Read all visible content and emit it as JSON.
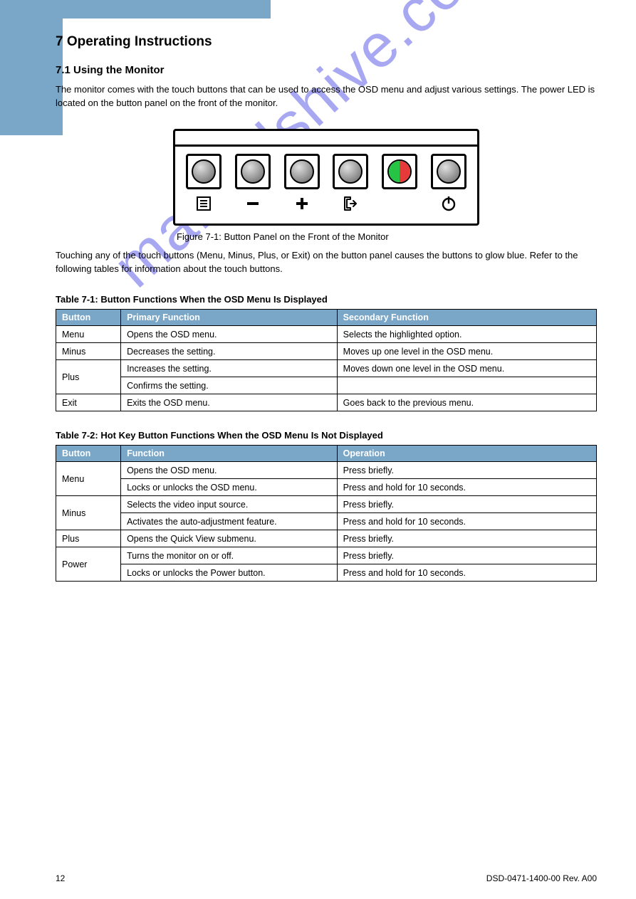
{
  "watermark": "manualshive.com",
  "section7": {
    "num": "7",
    "title": "Operating Instructions",
    "sub1": {
      "num": "7.1",
      "title": "Using the Monitor",
      "paragraph": "The monitor comes with the touch buttons that can be used to access the OSD menu and adjust various settings. The power LED is located on the button panel on the front of the monitor.",
      "figure_caption": "Figure 7-1: Button Panel on the Front of the Monitor",
      "explain": "Touching any of the touch buttons (Menu, Minus, Plus, or Exit) on the button panel causes the buttons to glow blue. Refer to the following tables for information about the touch buttons."
    },
    "table1": {
      "title": "Table 7-1: Button Functions When the OSD Menu Is Displayed",
      "headers": [
        "Button",
        "Primary Function",
        "Secondary Function"
      ],
      "rows": [
        [
          "Menu",
          "Opens the OSD menu.",
          "Selects the highlighted option."
        ],
        [
          "Minus",
          "Decreases the setting.",
          "Moves up one level in the OSD menu."
        ],
        [
          "Plus",
          "Increases the setting.",
          "Moves down one level in the OSD menu."
        ],
        [
          "",
          "Confirms the setting.",
          ""
        ],
        [
          "Exit",
          "Exits the OSD menu.",
          "Goes back to the previous menu."
        ]
      ]
    },
    "table2": {
      "title": "Table 7-2: Hot Key Button Functions When the OSD Menu Is Not Displayed",
      "headers": [
        "Button",
        "Function",
        "Operation"
      ],
      "rows": [
        [
          "Menu",
          "Opens the OSD menu.",
          "Press briefly."
        ],
        [
          "",
          "Locks or unlocks the OSD menu.",
          "Press and hold for 10 seconds."
        ],
        [
          "Minus",
          "Selects the video input source.",
          "Press briefly."
        ],
        [
          "",
          "Activates the auto-adjustment feature.",
          "Press and hold for 10 seconds."
        ],
        [
          "Plus",
          "Opens the Quick View submenu.",
          "Press briefly."
        ],
        [
          "Power",
          "Turns the monitor on or off.",
          "Press briefly."
        ],
        [
          "",
          "Locks or unlocks the Power button.",
          "Press and hold for 10 seconds."
        ]
      ]
    }
  },
  "footer": {
    "page": "12",
    "revision": "DSD-0471-1400-00 Rev. A00"
  }
}
